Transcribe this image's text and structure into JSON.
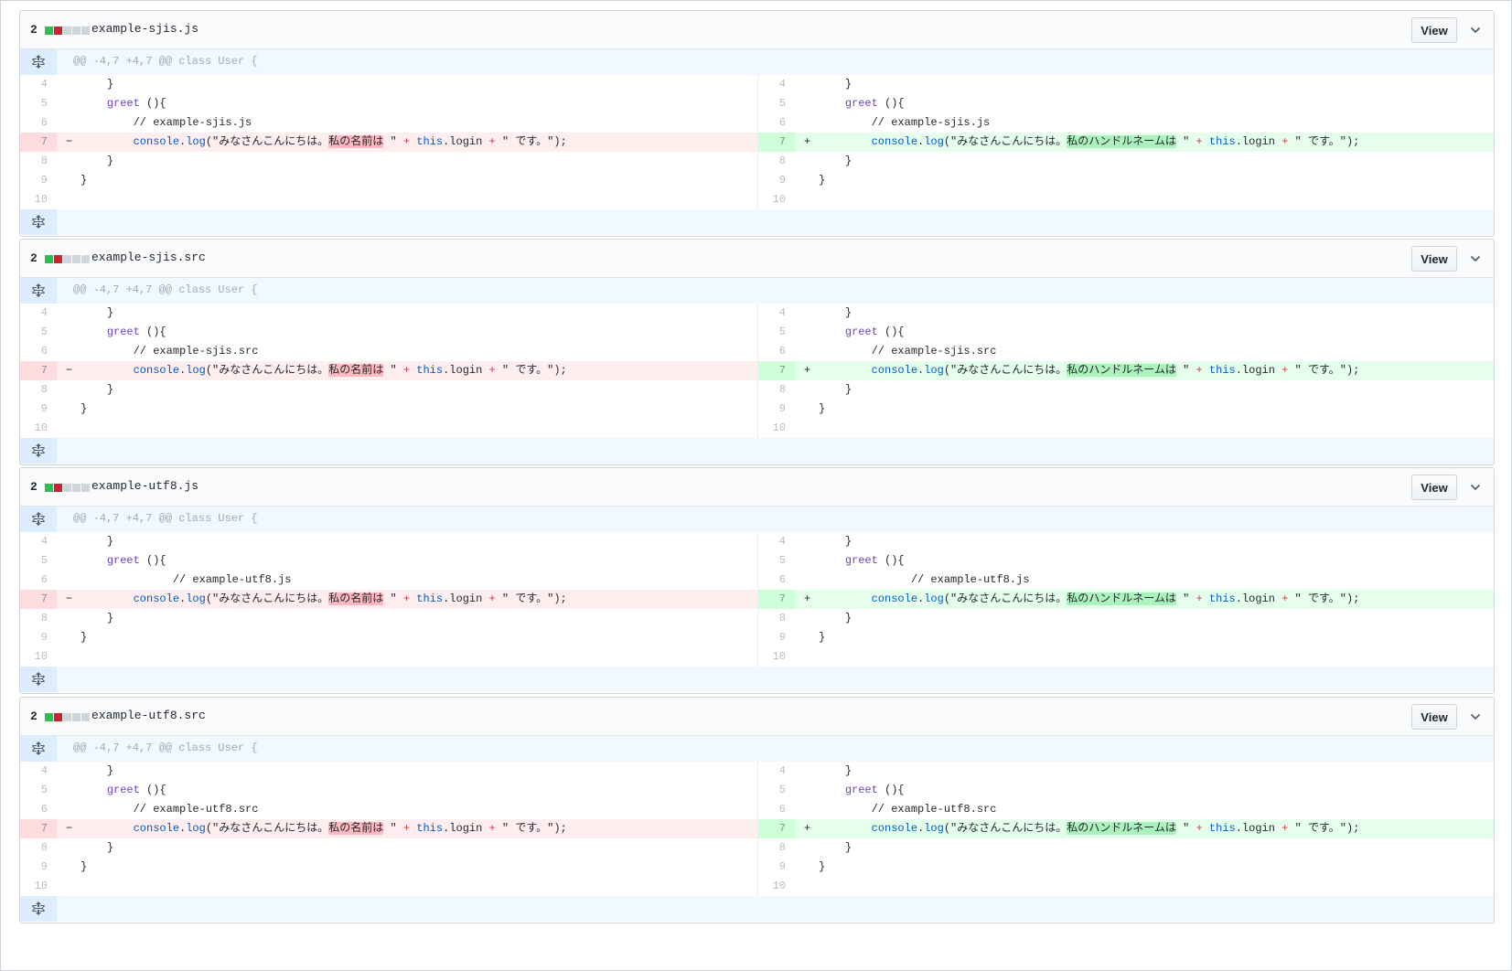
{
  "files": [
    {
      "stat_count": "2",
      "name": "example-sjis.js",
      "view_label": "View",
      "hunk": "@@ -4,7 +4,7 @@ class User {",
      "comment_indent": 4,
      "comment": "// example-sjis.js"
    },
    {
      "stat_count": "2",
      "name": "example-sjis.src",
      "view_label": "View",
      "hunk": "@@ -4,7 +4,7 @@ class User {",
      "comment_indent": 4,
      "comment": "// example-sjis.src"
    },
    {
      "stat_count": "2",
      "name": "example-utf8.js",
      "view_label": "View",
      "hunk": "@@ -4,7 +4,7 @@ class User {",
      "comment_indent": 10,
      "comment": "// example-utf8.js"
    },
    {
      "stat_count": "2",
      "name": "example-utf8.src",
      "view_label": "View",
      "hunk": "@@ -4,7 +4,7 @@ class User {",
      "comment_indent": 4,
      "comment": "// example-utf8.src"
    }
  ],
  "common": {
    "line_numbers": [
      "4",
      "5",
      "6",
      "7",
      "8",
      "9",
      "10"
    ],
    "brace_close_indent": "}",
    "greet": "greet",
    "greet_rest": " (){",
    "class_close": "}",
    "del_marker": "−",
    "add_marker": "+",
    "console": "console",
    "log": "log",
    "str_open": "(\"みなさんこんにちは。",
    "del_highlight": "私の名前は",
    "add_highlight": "私のハンドルネームは",
    "str_close_1": " \" ",
    "plus": "+",
    "this": "this",
    "login": ".login ",
    "str_tail": " \" です。\");"
  },
  "diffstat_blocks": [
    "add",
    "del",
    "neu",
    "neu",
    "neu"
  ],
  "colors": {
    "add_line_bg": "#e6ffed",
    "del_line_bg": "#ffeef0",
    "add_highlight": "#acf2bd",
    "del_highlight": "#fdb8c0",
    "hunk_bg": "#f1f8ff"
  },
  "icons": {
    "expand": "unfold-icon",
    "collapse": "chevron-down-icon"
  }
}
